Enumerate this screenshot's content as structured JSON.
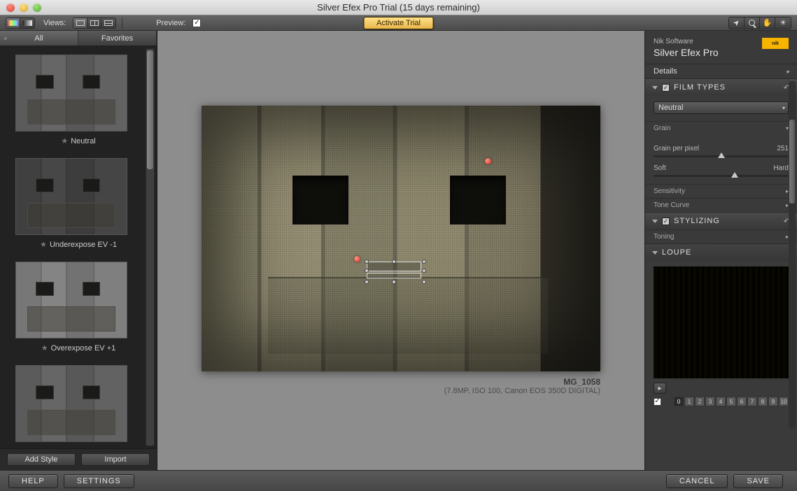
{
  "window": {
    "title": "Silver Efex Pro Trial (15 days remaining)"
  },
  "toolbar": {
    "views_label": "Views:",
    "preview_label": "Preview:",
    "preview_checked": "✓",
    "activate": "Activate Trial"
  },
  "left": {
    "tabs": {
      "all": "All",
      "favorites": "Favorites"
    },
    "thumbs": [
      {
        "label": "Neutral"
      },
      {
        "label": "Underexpose EV -1"
      },
      {
        "label": "Overexpose EV +1"
      },
      {
        "label": ""
      }
    ],
    "add_style": "Add Style",
    "import": "Import"
  },
  "center": {
    "image_name": "MG_1058",
    "image_meta": "(7.8MP, ISO 100, Canon EOS 350D DIGITAL)"
  },
  "right": {
    "company": "Nik Software",
    "product": "Silver Efex Pro",
    "logo": "nik",
    "details": "Details",
    "film_types": "FILM TYPES",
    "film_select": "Neutral",
    "grain_label": "Grain",
    "grain_per_pixel_label": "Grain per pixel",
    "grain_per_pixel_value": "251",
    "soft": "Soft",
    "hard": "Hard",
    "sensitivity": "Sensitivity",
    "tone_curve": "Tone Curve",
    "stylizing": "STYLIZING",
    "toning": "Toning",
    "loupe": "LOUPE",
    "check": "✓",
    "numbers": [
      "0",
      "1",
      "2",
      "3",
      "4",
      "5",
      "6",
      "7",
      "8",
      "9",
      "10"
    ]
  },
  "bottom": {
    "help": "HELP",
    "settings": "SETTINGS",
    "cancel": "CANCEL",
    "save": "SAVE"
  }
}
